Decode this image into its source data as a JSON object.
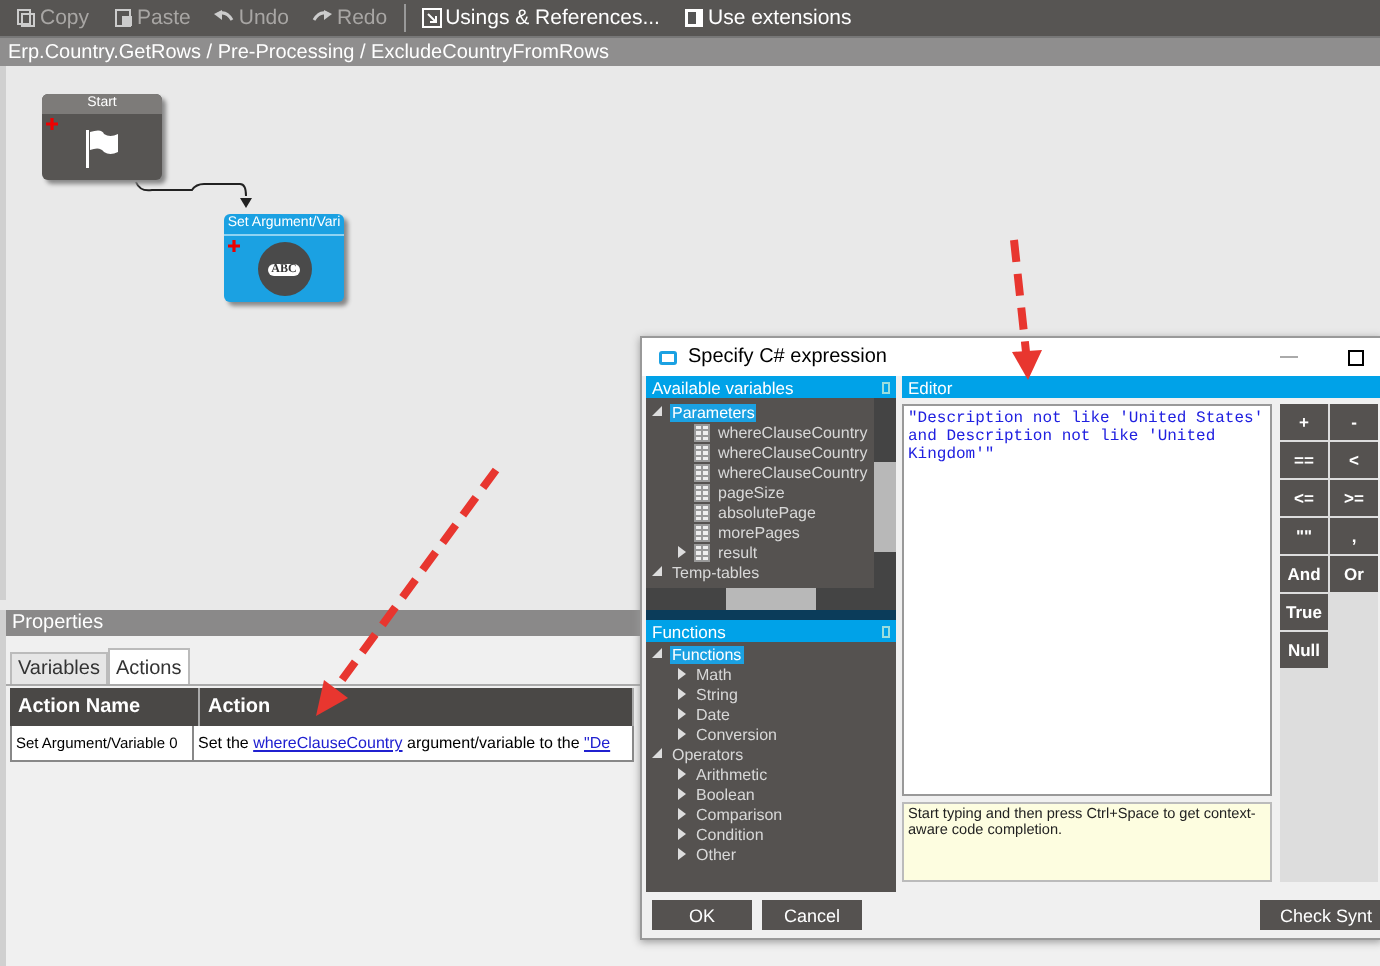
{
  "toolbar": [
    [
      {
        "label": "Copy",
        "disabled": true
      },
      {
        "label": "Paste",
        "disabled": true
      },
      {
        "label": "Undo",
        "disabled": true
      },
      {
        "label": "Redo",
        "disabled": true
      }
    ],
    [
      {
        "label": "Usings & References...",
        "disabled": false
      },
      {
        "label": "Use extensions",
        "disabled": false
      }
    ]
  ],
  "breadcrumb": "Erp.Country.GetRows / Pre-Processing / ExcludeCountryFromRows",
  "canvas": {
    "nodes": [
      {
        "kind": "start",
        "title": "Start"
      },
      {
        "kind": "set",
        "title": "Set Argument/Vari",
        "badge": "ABC"
      }
    ]
  },
  "properties": {
    "title": "Properties",
    "tabs": [
      {
        "label": "Variables",
        "selected": false
      },
      {
        "label": "Actions",
        "selected": true
      }
    ],
    "columns": [
      "Action Name",
      "Action"
    ],
    "rows": [
      {
        "name": "Set Argument/Variable 0",
        "action": [
          {
            "kind": "text",
            "text": "Set the "
          },
          {
            "kind": "link",
            "text": "whereClauseCountry"
          },
          {
            "kind": "text",
            "text": " argument/variable to the "
          },
          {
            "kind": "link",
            "text": "\"De"
          }
        ]
      }
    ]
  },
  "dialog": {
    "title": "Specify C# expression",
    "variables": {
      "title": "Available variables",
      "tree": [
        {
          "label": "Parameters",
          "expanded": true,
          "selected": true,
          "children": [
            {
              "label": "whereClauseCountry",
              "selected": false
            },
            {
              "label": "whereClauseCountry",
              "selected": false
            },
            {
              "label": "whereClauseCountry",
              "selected": false
            },
            {
              "label": "pageSize",
              "selected": false
            },
            {
              "label": "absolutePage",
              "selected": false
            },
            {
              "label": "morePages",
              "selected": false
            },
            {
              "label": "result",
              "expanded": false,
              "selected": false
            }
          ]
        },
        {
          "label": "Temp-tables",
          "expanded": true,
          "selected": false
        }
      ]
    },
    "functions": {
      "title": "Functions",
      "tree": [
        {
          "label": "Functions",
          "expanded": true,
          "selected": true,
          "children": [
            {
              "label": "Math",
              "expanded": false,
              "selected": false
            },
            {
              "label": "String",
              "expanded": false,
              "selected": false
            },
            {
              "label": "Date",
              "expanded": false,
              "selected": false
            },
            {
              "label": "Conversion",
              "expanded": false,
              "selected": false
            }
          ]
        },
        {
          "label": "Operators",
          "expanded": true,
          "selected": false,
          "children": [
            {
              "label": "Arithmetic",
              "expanded": false,
              "selected": false
            },
            {
              "label": "Boolean",
              "expanded": false,
              "selected": false
            },
            {
              "label": "Comparison",
              "expanded": false,
              "selected": false
            },
            {
              "label": "Condition",
              "expanded": false,
              "selected": false
            },
            {
              "label": "Other",
              "expanded": false,
              "selected": false
            }
          ]
        }
      ]
    },
    "editor": {
      "title": "Editor",
      "value": "\"Description not like 'United States' and Description not like 'United Kingdom'\"",
      "hint": "Start typing and then press Ctrl+Space to get context-aware code completion."
    },
    "keypad": [
      [
        "+",
        "-"
      ],
      [
        "==",
        "<"
      ],
      [
        "<=",
        ">="
      ],
      [
        "\"\"",
        ","
      ],
      [
        "And",
        "Or"
      ],
      [
        "True"
      ],
      [
        "Null"
      ]
    ],
    "buttons": [
      "OK",
      "Cancel",
      "Check Synt"
    ]
  }
}
